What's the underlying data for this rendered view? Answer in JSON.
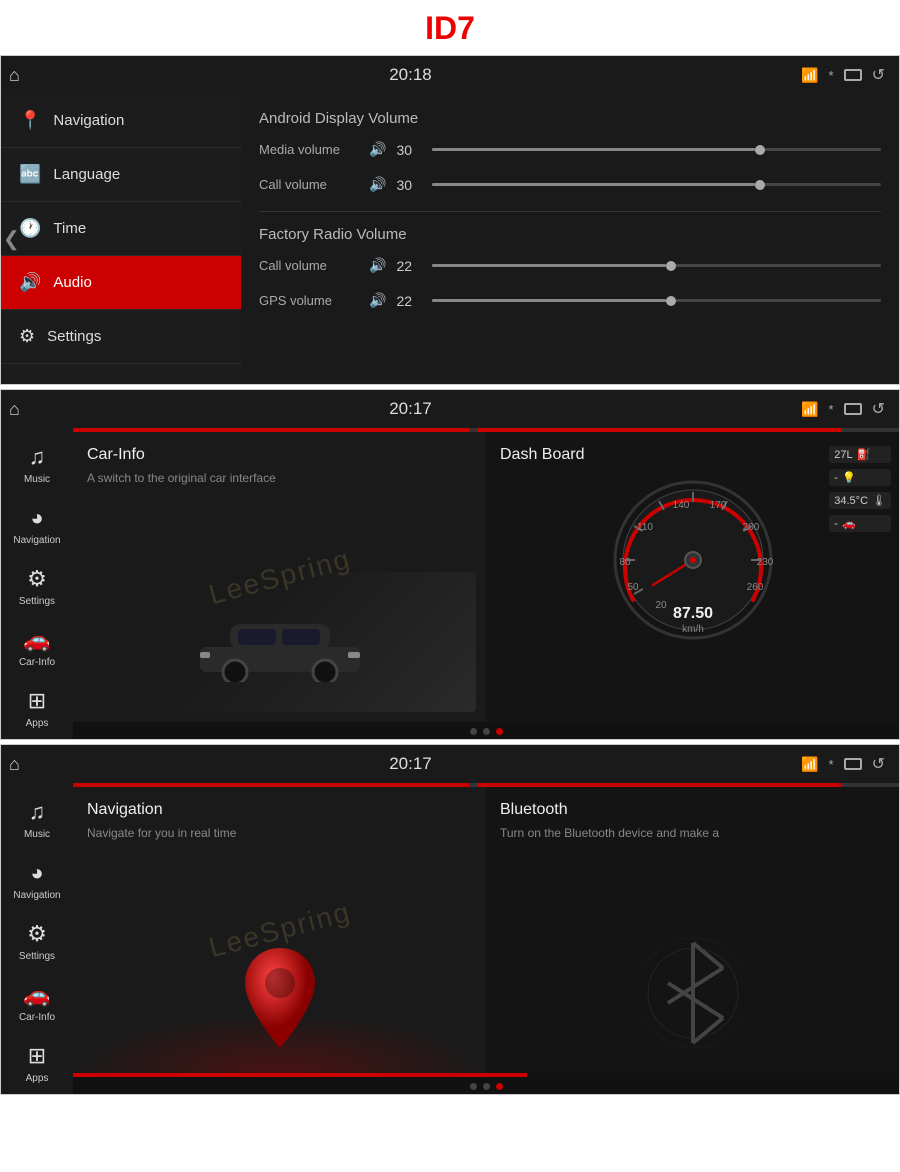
{
  "title": "ID7",
  "screen1": {
    "time": "20:18",
    "sidebar": {
      "items": [
        {
          "id": "navigation",
          "label": "Navigation",
          "icon": "📍",
          "active": false
        },
        {
          "id": "language",
          "label": "Language",
          "icon": "🔤",
          "active": false
        },
        {
          "id": "time",
          "label": "Time",
          "icon": "🕐",
          "active": false
        },
        {
          "id": "audio",
          "label": "Audio",
          "icon": "🔊",
          "active": true
        },
        {
          "id": "settings",
          "label": "Settings",
          "icon": "⚙",
          "active": false
        }
      ]
    },
    "content": {
      "androidTitle": "Android Display Volume",
      "factoryTitle": "Factory Radio Volume",
      "rows": [
        {
          "label": "Media volume",
          "value": "30",
          "fillPct": 72
        },
        {
          "label": "Call volume",
          "value": "30",
          "fillPct": 72
        },
        {
          "label": "Call volume",
          "value": "22",
          "fillPct": 52
        },
        {
          "label": "GPS volume",
          "value": "22",
          "fillPct": 52
        }
      ]
    }
  },
  "screen2": {
    "time": "20:17",
    "nav_items": [
      {
        "id": "music",
        "label": "Music",
        "icon": "♪"
      },
      {
        "id": "navigation",
        "label": "Navigation",
        "icon": "◎"
      },
      {
        "id": "settings",
        "label": "Settings",
        "icon": "⚙"
      },
      {
        "id": "car-info",
        "label": "Car-Info",
        "icon": "🚗"
      },
      {
        "id": "apps",
        "label": "Apps",
        "icon": "⊞"
      }
    ],
    "leftPanel": {
      "title": "Car-Info",
      "desc": "A switch to the original car interface"
    },
    "rightPanel": {
      "title": "Dash Board",
      "speed": "87.50",
      "unit": "km/h"
    },
    "rightStats": [
      {
        "value": "27L",
        "icon": "⛽"
      },
      {
        "value": "-",
        "icon": "💡"
      },
      {
        "value": "34.5°C",
        "icon": "🌡"
      },
      {
        "value": "-",
        "icon": "🚗"
      }
    ]
  },
  "screen3": {
    "time": "20:17",
    "nav_items": [
      {
        "id": "music",
        "label": "Music",
        "icon": "♪"
      },
      {
        "id": "navigation",
        "label": "Navigation",
        "icon": "◎"
      },
      {
        "id": "settings",
        "label": "Settings",
        "icon": "⚙"
      },
      {
        "id": "car-info",
        "label": "Car-Info",
        "icon": "🚗"
      },
      {
        "id": "apps",
        "label": "Apps",
        "icon": "⊞"
      }
    ],
    "leftPanel": {
      "title": "Navigation",
      "desc": "Navigate for you in real time"
    },
    "rightPanel": {
      "title": "Bluetooth",
      "desc": "Turn on the Bluetooth device and make a"
    }
  },
  "dots1": [
    false,
    false,
    true
  ],
  "dots2": [
    false,
    false,
    true
  ]
}
